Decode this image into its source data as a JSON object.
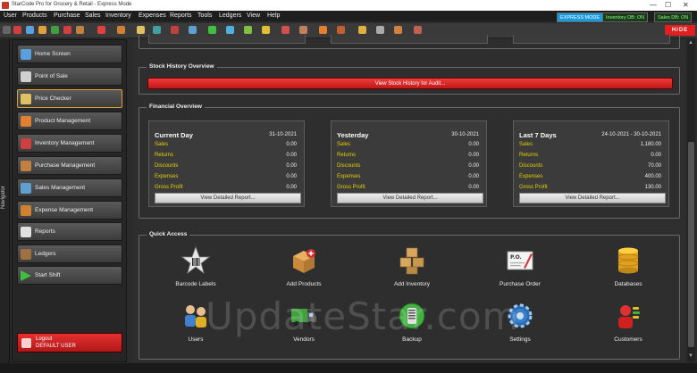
{
  "window": {
    "title": "StarCode Pro for Grocery & Retail - Express Mode",
    "controls": [
      "—",
      "☐",
      "✕"
    ]
  },
  "menu": [
    "User",
    "Products",
    "Purchase",
    "Sales",
    "Inventory",
    "Expenses",
    "Reports",
    "Tools",
    "Ledgers",
    "View",
    "Help"
  ],
  "badges": {
    "express": "EXPRESS MODE",
    "inventory_db": "Inventory DB: ON",
    "sales_db": "Sales DB: ON"
  },
  "toolbar": {
    "hide_label": "HIDE"
  },
  "navigator": {
    "label": "Navigator",
    "items": [
      {
        "label": "Home Screen",
        "icon": "home-icon",
        "color": "#5aa0e0"
      },
      {
        "label": "Point of Sale",
        "icon": "pos-icon",
        "color": "#d0d0d0"
      },
      {
        "label": "Price Checker",
        "icon": "tag-icon",
        "color": "#e0c060",
        "selected": true
      },
      {
        "label": "Product Management",
        "icon": "box-icon",
        "color": "#e08030"
      },
      {
        "label": "Inventory Management",
        "icon": "inventory-icon",
        "color": "#d04040"
      },
      {
        "label": "Purchase Management",
        "icon": "purchase-icon",
        "color": "#c08040"
      },
      {
        "label": "Sales Management",
        "icon": "sales-icon",
        "color": "#60a0d0"
      },
      {
        "label": "Expense Management",
        "icon": "expense-icon",
        "color": "#d08030"
      },
      {
        "label": "Reports",
        "icon": "report-icon",
        "color": "#e0e0e0"
      },
      {
        "label": "Ledgers",
        "icon": "ledger-icon",
        "color": "#a07040"
      },
      {
        "label": "Start Shift",
        "icon": "play-icon",
        "color": "#40c040"
      }
    ],
    "logout": {
      "line1": "Logout",
      "line2": "DEFAULT USER"
    }
  },
  "stock_history": {
    "title": "Stock History Overview",
    "button": "View Stock History for Audit..."
  },
  "financial": {
    "title": "Financial Overview",
    "row_labels": [
      "Sales",
      "Returns",
      "Discounts",
      "Expenses",
      "Gross Profit"
    ],
    "view_button": "View Detailed Report...",
    "cards": [
      {
        "heading": "Current Day",
        "date": "31-10-2021",
        "values": [
          "0.00",
          "0.00",
          "0.00",
          "0.00",
          "0.00"
        ]
      },
      {
        "heading": "Yesterday",
        "date": "30-10-2021",
        "values": [
          "0.00",
          "0.00",
          "0.00",
          "0.00",
          "0.00"
        ]
      },
      {
        "heading": "Last 7 Days",
        "date": "24-10-2021 - 30-10-2021",
        "values": [
          "1,180.00",
          "0.00",
          "70.00",
          "400.00",
          "130.00"
        ]
      }
    ]
  },
  "quick_access": {
    "title": "Quick Access",
    "items": [
      {
        "label": "Barcode Labels",
        "icon": "barcode-star-icon"
      },
      {
        "label": "Add Products",
        "icon": "add-box-icon"
      },
      {
        "label": "Add Inventory",
        "icon": "boxes-icon"
      },
      {
        "label": "Purchase Order",
        "icon": "purchase-order-icon"
      },
      {
        "label": "Databases",
        "icon": "database-icon"
      },
      {
        "label": "Users",
        "icon": "users-icon"
      },
      {
        "label": "Vendors",
        "icon": "truck-icon"
      },
      {
        "label": "Backup",
        "icon": "backup-icon"
      },
      {
        "label": "Settings",
        "icon": "gear-icon"
      },
      {
        "label": "Customers",
        "icon": "customers-icon"
      }
    ]
  },
  "watermark": "UpdateStar.com"
}
